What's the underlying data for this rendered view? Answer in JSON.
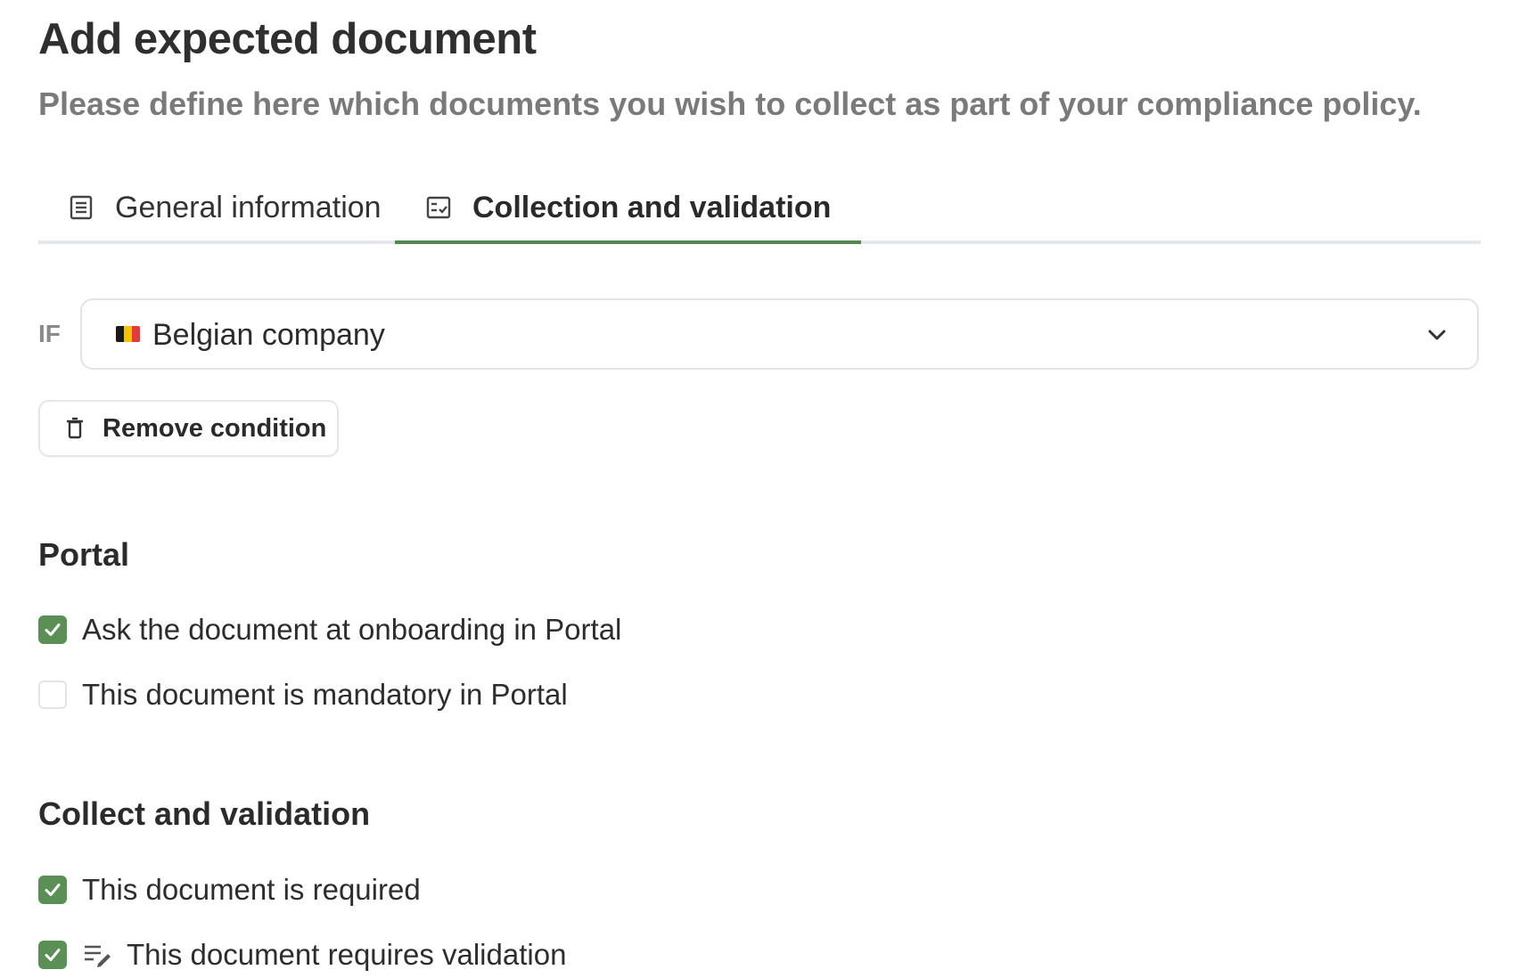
{
  "header": {
    "title": "Add expected document",
    "subtitle": "Please define here which documents you wish to collect as part of your compliance policy."
  },
  "tabs": [
    {
      "label": "General information",
      "icon": "list-document-icon",
      "active": false
    },
    {
      "label": "Collection and validation",
      "icon": "checklist-icon",
      "active": true
    }
  ],
  "condition": {
    "prefix": "IF",
    "selected_value": "Belgian company",
    "flag": "belgium-flag",
    "flag_colors": [
      "#1a1a1a",
      "#f5c400",
      "#e23b3b"
    ],
    "remove_label": "Remove condition"
  },
  "portal": {
    "title": "Portal",
    "options": [
      {
        "label": "Ask the document at onboarding in Portal",
        "checked": true
      },
      {
        "label": "This document is mandatory in Portal",
        "checked": false
      }
    ]
  },
  "collect": {
    "title": "Collect and validation",
    "options": [
      {
        "label": "This document is required",
        "checked": true
      },
      {
        "label": "This document requires validation",
        "checked": true,
        "icon": "edit-list-icon"
      }
    ]
  },
  "colors": {
    "accent": "#4f8a4c",
    "checkbox_checked": "#5a8f56",
    "title_text": "#2f2f2f",
    "subtitle_text": "#7a7a7a",
    "border": "#e1e4e8"
  }
}
